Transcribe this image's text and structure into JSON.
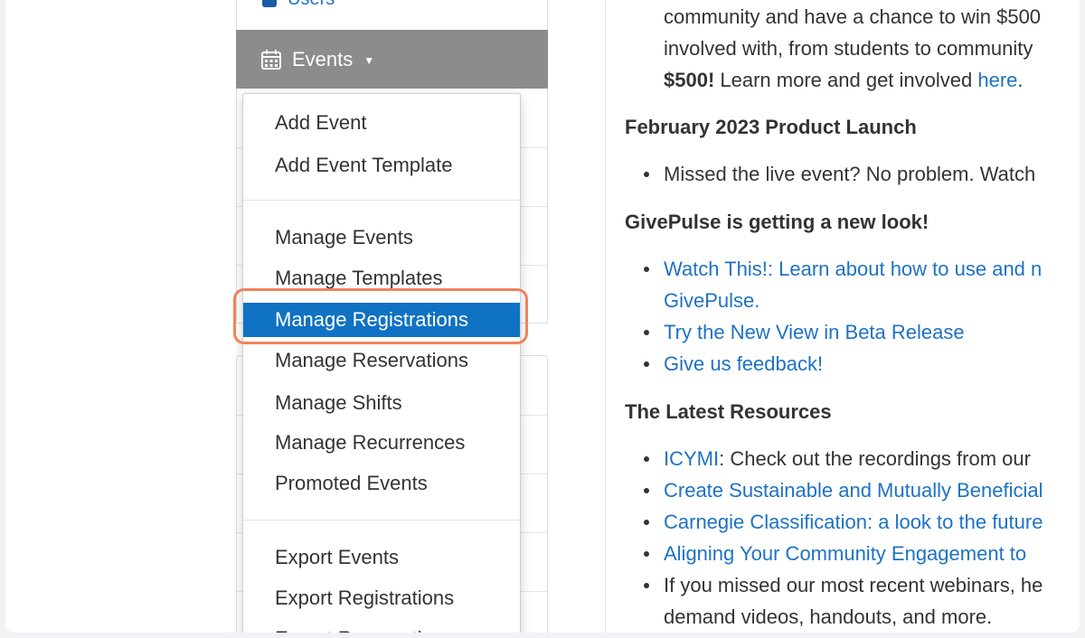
{
  "sidebar": {
    "users_label": "Users",
    "events_label": "Events"
  },
  "dropdown": {
    "items": [
      {
        "label": "Add Event"
      },
      {
        "label": "Add Event Template"
      },
      {
        "label": "Manage Events"
      },
      {
        "label": "Manage Templates"
      },
      {
        "label": "Manage Registrations",
        "active": true
      },
      {
        "label": "Manage Reservations"
      },
      {
        "label": "Manage Shifts"
      },
      {
        "label": "Manage Recurrences"
      },
      {
        "label": "Promoted Events"
      },
      {
        "label": "Export Events"
      },
      {
        "label": "Export Registrations"
      },
      {
        "label": "Export Reservations"
      }
    ]
  },
  "content": {
    "intro": {
      "line1": "community and have a chance to win $500",
      "line2": "involved with, from students to community",
      "line3_bold": "$500!",
      "line3_text": " Learn more and get involved ",
      "line3_link": "here",
      "line3_end": "."
    },
    "section1": {
      "heading": "February 2023 Product Launch",
      "bullet1": "Missed the live event? No problem. Watch"
    },
    "section2": {
      "heading": "GivePulse is getting a new look!",
      "bullet1_line1": "Watch This!: Learn about how to use and n",
      "bullet1_line2": "GivePulse.",
      "bullet2": "Try the New View in Beta Release",
      "bullet3": "Give us feedback!"
    },
    "section3": {
      "heading": "The Latest Resources",
      "bullet1_link": "ICYMI",
      "bullet1_text": ": Check out the recordings from our",
      "bullet2": "Create Sustainable and Mutually Beneficial",
      "bullet3": "Carnegie Classification: a look to the future",
      "bullet4": "Aligning Your Community Engagement to",
      "bullet5_line1": "If you missed our most recent webinars, he",
      "bullet5_line2": "demand videos, handouts, and more."
    }
  },
  "colors": {
    "link": "#1e72c4",
    "active_item": "#0f72c3",
    "highlight_ring": "#f0825c",
    "events_header": "#8c8c8c"
  }
}
